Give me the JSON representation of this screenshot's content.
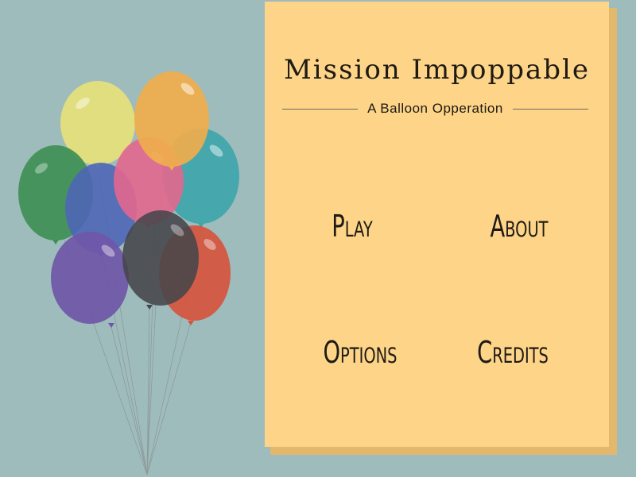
{
  "game": {
    "title": "Mission Impoppable",
    "subtitle": "A Balloon Opperation"
  },
  "menu": {
    "play_label": "Play",
    "about_label": "About",
    "options_label": "Options",
    "credits_label": "Credits"
  },
  "colors": {
    "background": "#9fbcbd",
    "panel": "#fdd488",
    "panel_shadow": "#e3b86c",
    "text": "#1e1a14"
  },
  "balloons": [
    {
      "name": "yellow-balloon",
      "color": "#e6e17a"
    },
    {
      "name": "orange-balloon",
      "color": "#f0ad4c"
    },
    {
      "name": "green-balloon",
      "color": "#3f8f55"
    },
    {
      "name": "teal-balloon",
      "color": "#3ea6aa"
    },
    {
      "name": "pink-balloon",
      "color": "#e2678e"
    },
    {
      "name": "blue-balloon",
      "color": "#4e66b5"
    },
    {
      "name": "purple-balloon",
      "color": "#6f56a8"
    },
    {
      "name": "red-balloon",
      "color": "#d5543d"
    },
    {
      "name": "dark-balloon",
      "color": "#46464a"
    }
  ]
}
